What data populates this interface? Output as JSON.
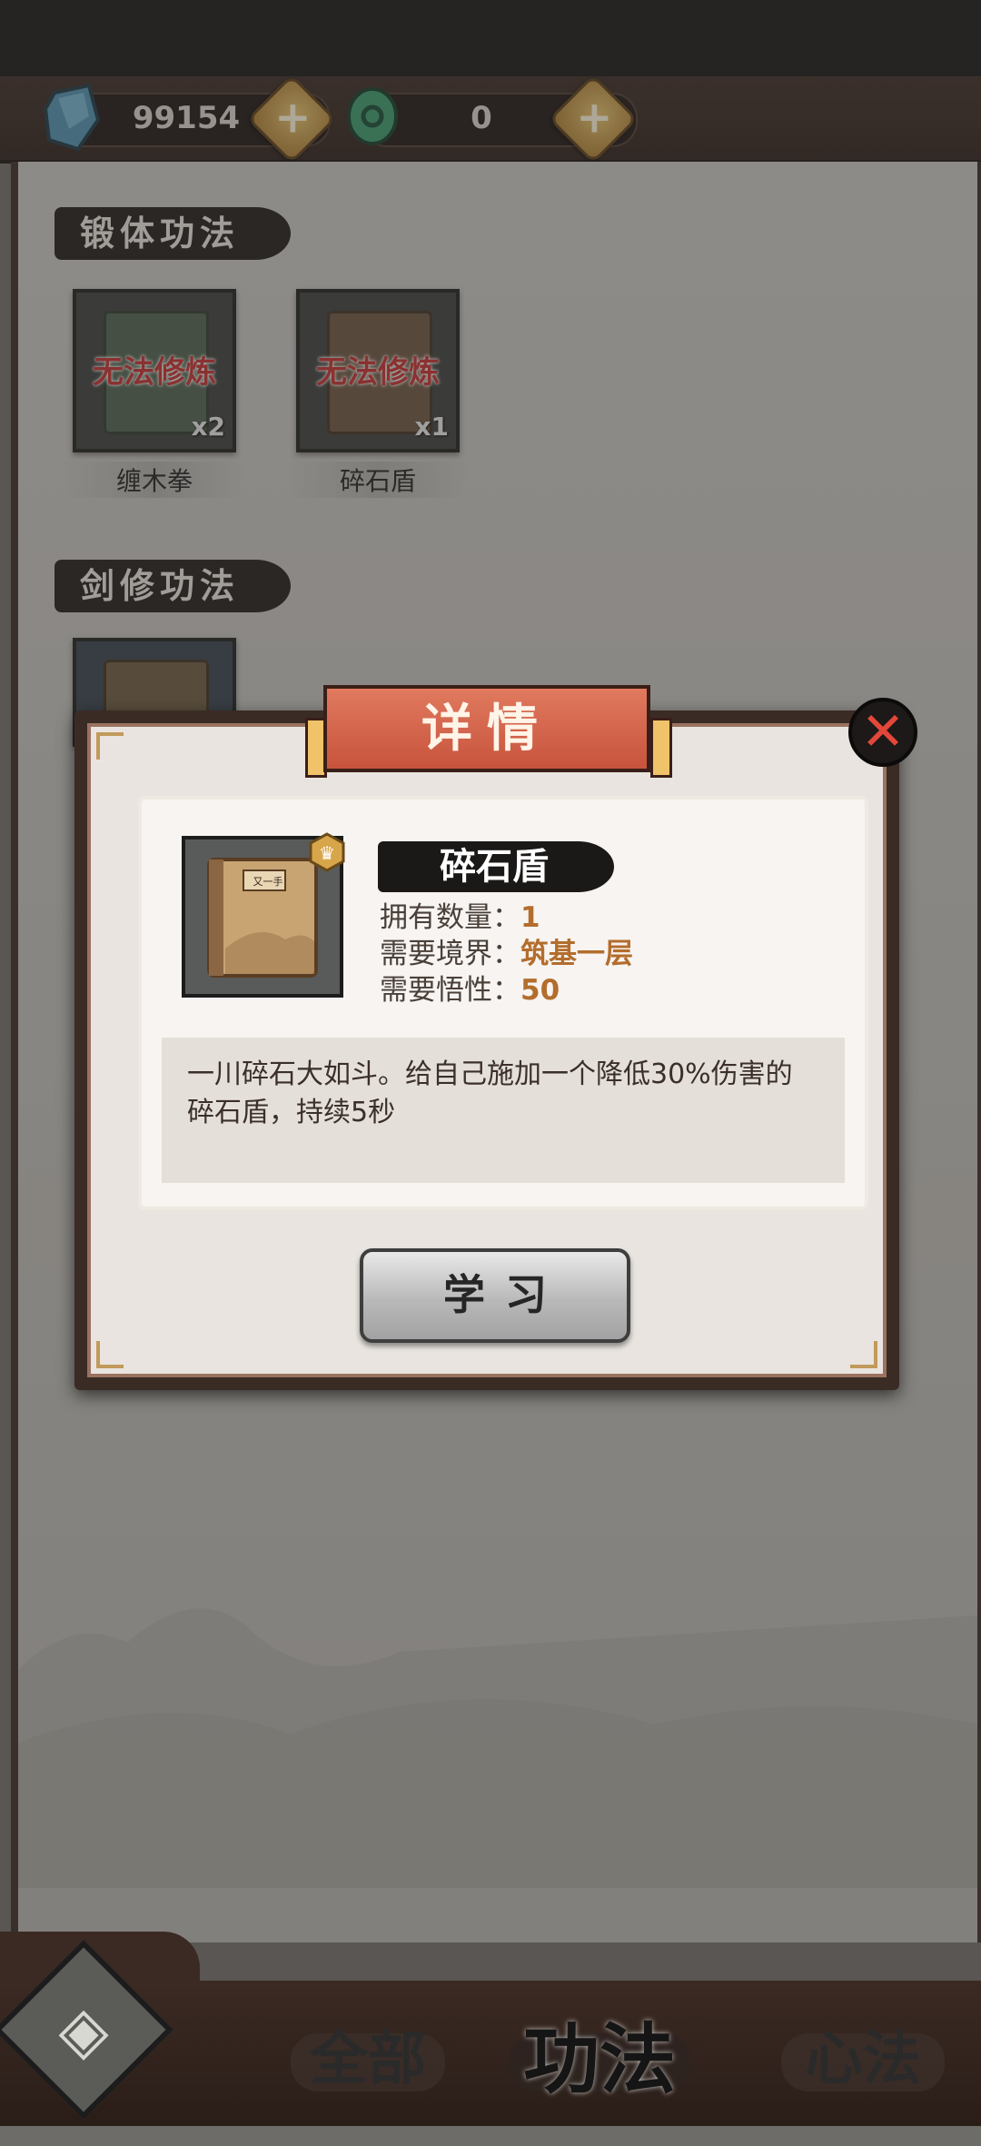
{
  "currencies": [
    {
      "name": "spirit-stone",
      "value": "99154",
      "color": "#4f8fb0"
    },
    {
      "name": "jade",
      "value": "0",
      "color": "#3a9a6b"
    }
  ],
  "sections": [
    {
      "title": "锻体功法",
      "items": [
        {
          "status": "无法修炼",
          "count": "x2",
          "name": "缠木拳",
          "book_color": "#4c5f4c"
        },
        {
          "status": "无法修炼",
          "count": "x1",
          "name": "碎石盾",
          "book_color": "#6b5440"
        }
      ]
    },
    {
      "title": "剑修功法",
      "items": []
    }
  ],
  "modal": {
    "title": "详情",
    "close_icon": "close-icon",
    "skill_name": "碎石盾",
    "stats": [
      {
        "label": "拥有数量：",
        "value": "1"
      },
      {
        "label": "需要境界：",
        "value": "筑基一层"
      },
      {
        "label": "需要悟性：",
        "value": "50"
      }
    ],
    "book_cover_text": "又一手",
    "description": "一川碎石大如斗。给自己施加一个降低30%伤害的碎石盾，持续5秒",
    "learn_button": "学习"
  },
  "nav": {
    "home_icon": "home-icon",
    "tabs": [
      {
        "label": "全部",
        "active": false
      },
      {
        "label": "功法",
        "active": true
      },
      {
        "label": "心法",
        "active": false
      }
    ]
  }
}
